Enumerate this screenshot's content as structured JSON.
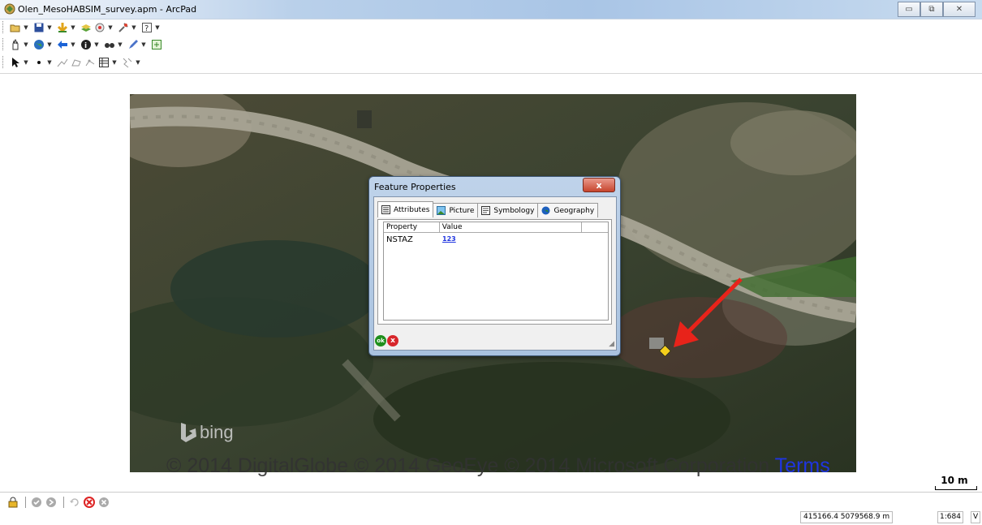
{
  "window": {
    "title": "Olen_MesoHABSIM_survey.apm - ArcPad",
    "controls": [
      "minimize",
      "maximize",
      "close"
    ]
  },
  "toolbars": {
    "row1": [
      "open-icon",
      "save-icon",
      "add-layer-icon",
      "layer-icon",
      "gps-icon",
      "tools-icon",
      "help-icon"
    ],
    "row2": [
      "pan-icon",
      "globe-icon",
      "back-icon",
      "info-icon",
      "find-icon",
      "edit-icon",
      "refresh-icon"
    ],
    "row3": [
      "select-arrow-icon",
      "point-icon",
      "polyline-icon",
      "polygon-icon",
      "vertex-icon",
      "table-icon",
      "snap-icon"
    ]
  },
  "map": {
    "attribution": "© 2014 DigitalGlobe © 2014 GeoEye © 2014 Microsoft Corporation",
    "terms_label": "Terms",
    "logo_text": "bing",
    "scale_bar_label": "10 m"
  },
  "dialog": {
    "title": "Feature Properties",
    "close_label": "x",
    "tabs": [
      {
        "label": "Attributes",
        "icon": "attributes-icon",
        "active": true
      },
      {
        "label": "Picture",
        "icon": "picture-icon",
        "active": false
      },
      {
        "label": "Symbology",
        "icon": "symbology-icon",
        "active": false
      },
      {
        "label": "Geography",
        "icon": "geography-icon",
        "active": false
      }
    ],
    "columns": [
      "Property",
      "Value"
    ],
    "rows": [
      {
        "property": "NSTAZ",
        "value": "123"
      }
    ],
    "ok_label": "ok",
    "cancel_label": "x"
  },
  "statusbar": {
    "coordinates": "415166.4 5079568.9 m",
    "scale": "1:684",
    "mode": "V"
  },
  "colors": {
    "arrow": "#e8231a",
    "marker": "#f5cf1b",
    "terms_link": "#1f35e0"
  }
}
